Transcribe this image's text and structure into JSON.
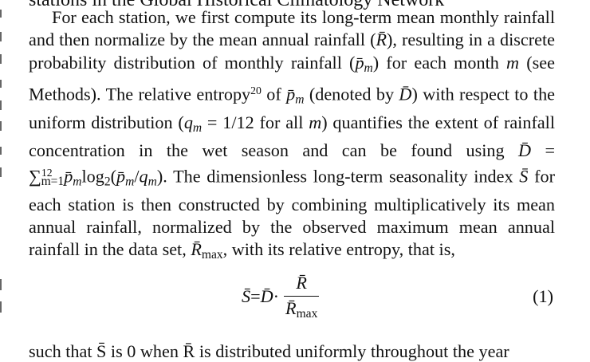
{
  "header_cut": "stations in the Global Historical Climatology Network",
  "paragraph": {
    "s1": "For each station, we first compute its long-term mean monthly rainfall and then normalize by the mean annual rainfall (",
    "rbar": "R̄",
    "s2": "), resulting in a discrete probability distribution of monthly rainfall (",
    "pbar": "p̄",
    "m": "m",
    "s3": ") for each month ",
    "s4": " (see Methods). The relative entropy",
    "ref": "20",
    "s5": " of ",
    "s6": "(denoted by ",
    "dbar": "D̄",
    "s7": ") with respect to the uniform distribution (",
    "q": "q",
    "s8": " = 1/12 for all ",
    "s9": ") quantifies the extent of rainfall concentration in the wet season and can be found using ",
    "s10": " = ∑",
    "sum_sub": "m=1",
    "sum_sup": "12",
    "log": "log",
    "log_sub": "2",
    "s11": "(",
    "s12": "/",
    "s13": "). The dimensionless long-term seasonality index ",
    "sbar": "S̄",
    "s14": " for each station is then constructed by combining multiplicatively its mean annual rainfall, normalized by the observed maximum mean annual rainfall in the data set, ",
    "max": "max",
    "s15": ", with its relative entropy, that is,",
    "highlight": "y",
    "seasonalit": "seasonalit"
  },
  "equation": {
    "lhs": "S̄",
    "eq": " = ",
    "d": "D̄",
    "dot": "·",
    "num": "R̄",
    "den": "R̄",
    "den_sub": "max",
    "number": "(1)"
  },
  "footer_cut": "such that S̄ is 0 when R̄ is distributed uniformly throughout the year"
}
